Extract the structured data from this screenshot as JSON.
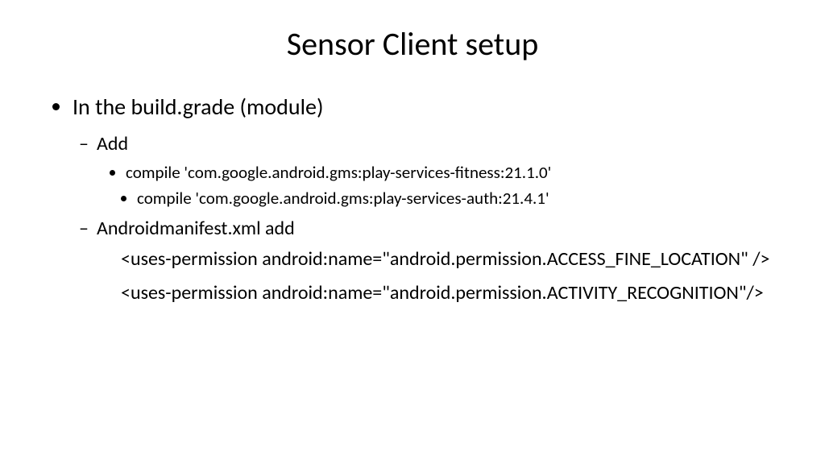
{
  "title": "Sensor Client setup",
  "bullets": {
    "level1_item1": "In the build.grade (module)",
    "level2_add": "Add",
    "level3_compile1": "compile 'com.google.android.gms:play-services-fitness:21.1.0'",
    "level3_compile2": "compile 'com.google.android.gms:play-services-auth:21.4.1'",
    "level2_manifest": "Androidmanifest.xml add",
    "perm1": "<uses-permission android:name=\"android.permission.ACCESS_FINE_LOCATION\" />",
    "perm2": "<uses-permission android:name=\"android.permission.ACTIVITY_RECOGNITION\"/>"
  }
}
